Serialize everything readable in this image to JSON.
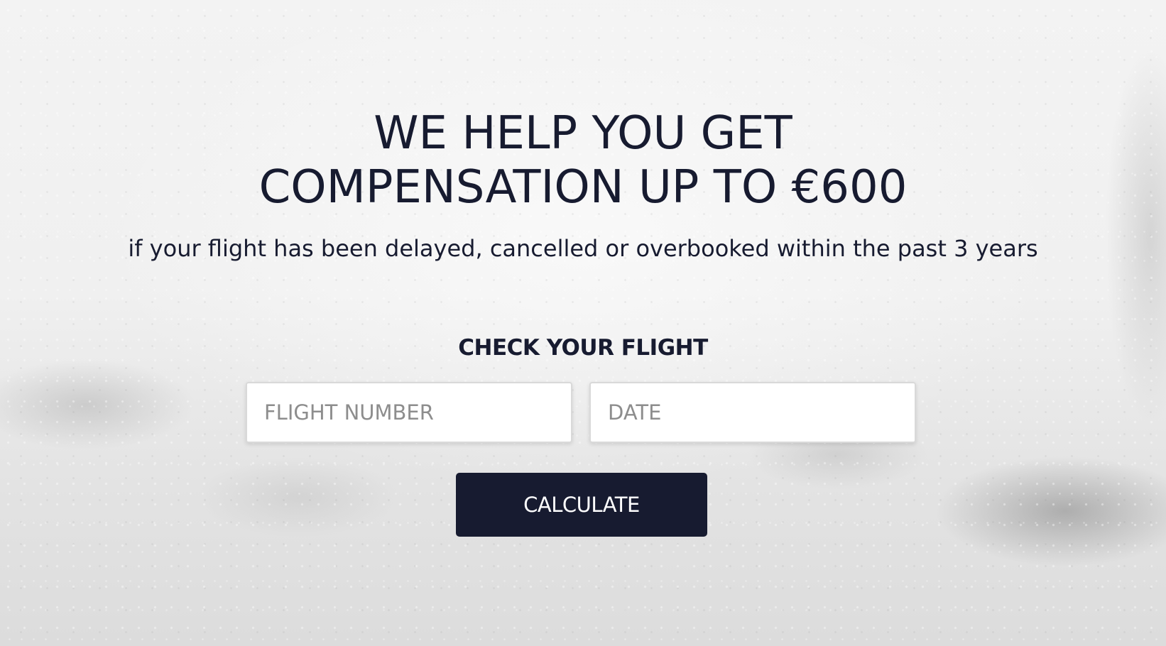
{
  "hero": {
    "headline_line1": "WE HELP YOU GET",
    "headline_line2": "COMPENSATION UP TO €600",
    "subheadline": "if your flight has been delayed, cancelled or overbooked within the past 3 years"
  },
  "form": {
    "title": "CHECK YOUR FLIGHT",
    "flight_number": {
      "placeholder": "FLIGHT NUMBER",
      "value": ""
    },
    "date": {
      "placeholder": "DATE",
      "value": ""
    },
    "submit_label": "CALCULATE"
  },
  "colors": {
    "text_primary": "#171b30",
    "button_background": "#171b30",
    "button_text": "#ffffff",
    "input_background": "#ffffff",
    "placeholder_text": "#8d8d8d"
  }
}
